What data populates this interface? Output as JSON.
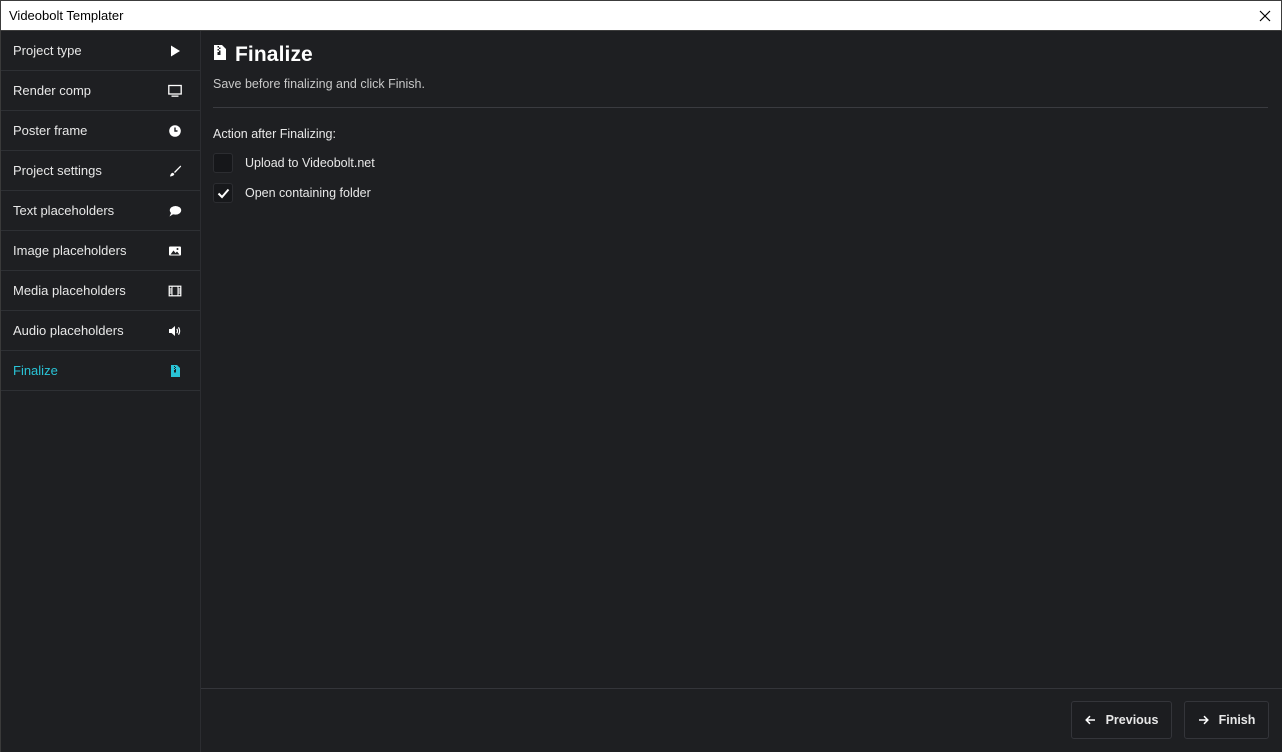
{
  "window": {
    "title": "Videobolt Templater"
  },
  "sidebar": {
    "items": [
      {
        "label": "Project type",
        "icon": "play-icon"
      },
      {
        "label": "Render comp",
        "icon": "monitor-icon"
      },
      {
        "label": "Poster frame",
        "icon": "clock-icon"
      },
      {
        "label": "Project settings",
        "icon": "brush-icon"
      },
      {
        "label": "Text placeholders",
        "icon": "speech-bubble-icon"
      },
      {
        "label": "Image placeholders",
        "icon": "image-icon"
      },
      {
        "label": "Media placeholders",
        "icon": "film-icon"
      },
      {
        "label": "Audio placeholders",
        "icon": "speaker-icon"
      },
      {
        "label": "Finalize",
        "icon": "file-zip-icon",
        "active": true
      }
    ],
    "active_color": "#29c3d6"
  },
  "main": {
    "title": "Finalize",
    "subtitle": "Save before finalizing and click Finish.",
    "section_label": "Action after Finalizing:",
    "options": [
      {
        "label": "Upload to Videobolt.net",
        "checked": false
      },
      {
        "label": "Open containing folder",
        "checked": true
      }
    ]
  },
  "footer": {
    "previous_label": "Previous",
    "finish_label": "Finish"
  }
}
